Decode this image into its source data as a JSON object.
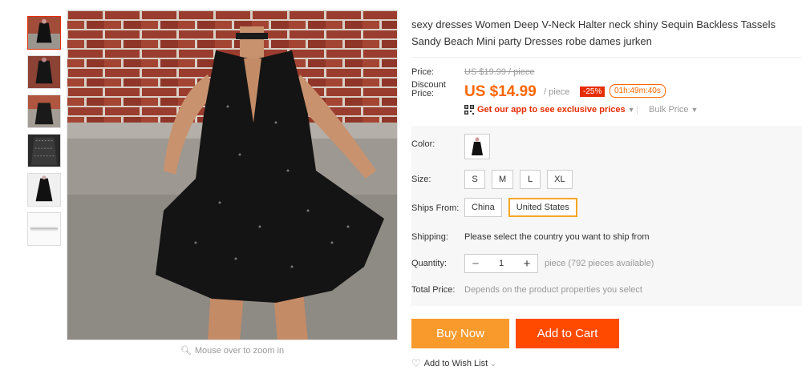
{
  "product": {
    "title": "sexy dresses Women Deep V-Neck Halter neck shiny Sequin Backless Tassels Sandy Beach Mini party Dresses robe dames jurken"
  },
  "gallery": {
    "zoom_hint": "Mouse over to zoom in",
    "thumbnail_count": 6
  },
  "pricing": {
    "price_label": "Price:",
    "original_price": "US $19.99 / piece",
    "discount_label_line1": "Discount",
    "discount_label_line2": "Price:",
    "discount_price": "US $14.99",
    "per_piece": "/ piece",
    "discount_badge": "-25%",
    "countdown": "01h:49m:40s",
    "app_promo": "Get our app to see exclusive prices",
    "bulk_price": "Bulk Price"
  },
  "properties": {
    "color_label": "Color:",
    "size_label": "Size:",
    "sizes": [
      "S",
      "M",
      "L",
      "XL"
    ],
    "ships_from_label": "Ships From:",
    "ships_from_options": [
      "China",
      "United States"
    ],
    "ships_from_selected": "United States",
    "shipping_label": "Shipping:",
    "shipping_text": "Please select the country you want to ship from",
    "quantity_label": "Quantity:",
    "quantity_value": "1",
    "quantity_availability": "piece (792 pieces available)",
    "total_label": "Total Price:",
    "total_text": "Depends on the product properties you select"
  },
  "actions": {
    "buy_now": "Buy Now",
    "add_to_cart": "Add to Cart",
    "wish_list": "Add to Wish List"
  },
  "colors": {
    "accent_orange": "#ff6600",
    "buy_now_bg": "#f89a2c",
    "add_to_cart_bg": "#ff4a00",
    "badge_red": "#e62e04"
  }
}
